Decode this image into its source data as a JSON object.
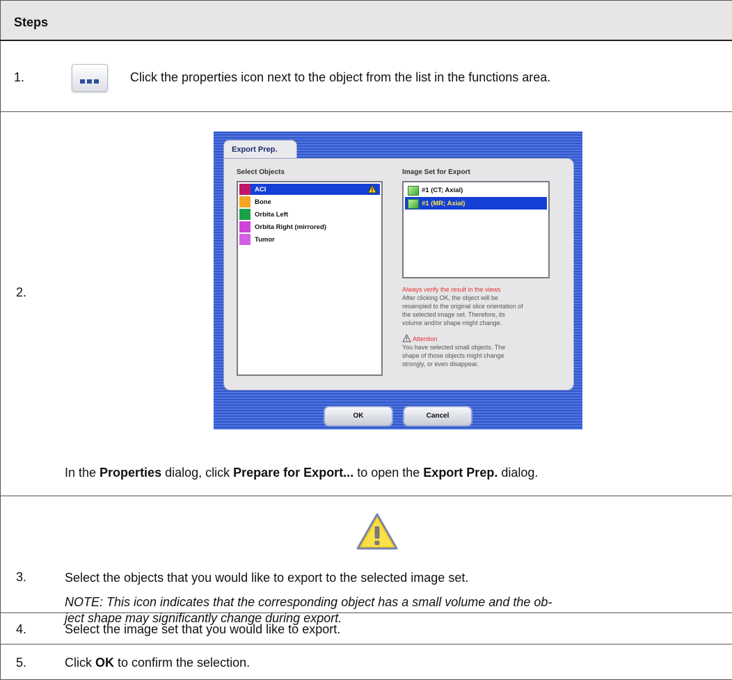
{
  "table": {
    "header": "Steps",
    "rows": [
      {
        "num": "1.",
        "text": "Click the properties icon next to the object from the list in the functions area."
      },
      {
        "num": "2.",
        "caption": {
          "p1": "In the ",
          "b1": "Properties",
          "p2": " dialog, click ",
          "b2": "Prepare for Export...",
          "p3": " to open the ",
          "b3": "Export Prep.",
          "p4": " dialog."
        }
      },
      {
        "num": "3.",
        "text": "Select the objects that you would like to export to the selected image set.",
        "note_line1": "NOTE: This icon indicates that the corresponding object has a small volume and the ob-",
        "note_line2": "ject shape may significantly change during export."
      },
      {
        "num": "4.",
        "text": "Select the image set that you would like to export."
      },
      {
        "num": "5.",
        "p1": "Click ",
        "b1": "OK",
        "p2": " to confirm the selection."
      }
    ]
  },
  "dialog": {
    "tab": "Export Prep.",
    "select_label": "Select Objects",
    "objects": [
      {
        "label": "ACI",
        "color": "#c0166a",
        "selected": true,
        "warning": true
      },
      {
        "label": "Bone",
        "color": "#f5a623",
        "selected": false
      },
      {
        "label": "Orbita Left",
        "color": "#19a04a",
        "selected": false
      },
      {
        "label": "Orbita Right (mirrored)",
        "color": "#cc44d9",
        "selected": false
      },
      {
        "label": "Tumor",
        "color": "#d45fe0",
        "selected": false
      }
    ],
    "image_set_label": "Image Set for Export",
    "image_sets": [
      {
        "label": "#1 (CT; Axial)",
        "selected": false
      },
      {
        "label": "#1 (MR; Axial)",
        "selected": true
      }
    ],
    "verify_title": "Always verify the result in the views",
    "verify_lines": [
      "After clicking OK, the object will be",
      "resampled to the original slice orientation of",
      "the selected image set. Therefore, its",
      "volume and/or shape might change."
    ],
    "attention_title": "Attention",
    "attention_lines": [
      "You have selected small objects. The",
      "shape of those objects might change",
      "strongly, or even disappear."
    ],
    "ok": "OK",
    "cancel": "Cancel"
  },
  "colors": {
    "dialog_blue": "#3357c8",
    "selection": "#1540d6",
    "warning": "#e23030"
  }
}
